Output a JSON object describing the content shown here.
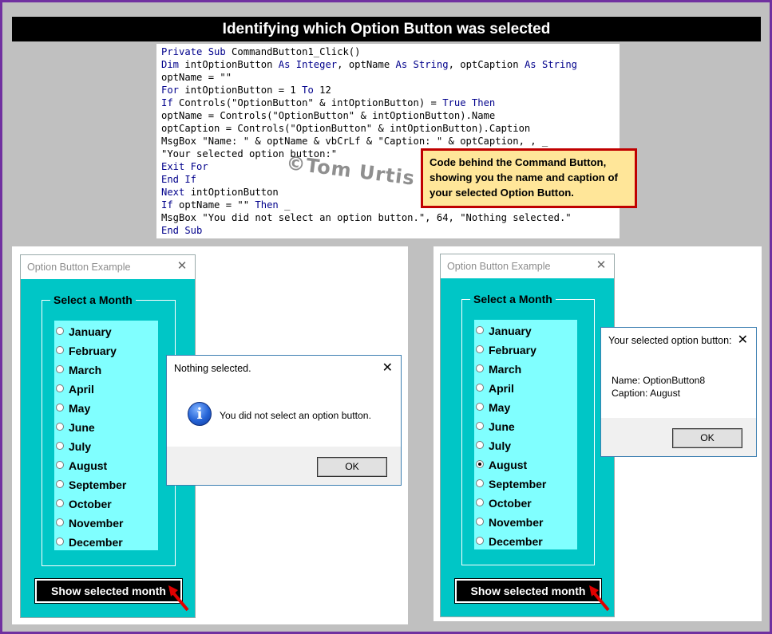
{
  "header": {
    "title": "Identifying which Option Button was selected"
  },
  "code": {
    "lines": [
      [
        {
          "t": "Private Sub",
          "k": true
        },
        {
          "t": " CommandButton1_Click()",
          "k": false
        }
      ],
      [
        {
          "t": "Dim",
          "k": true
        },
        {
          "t": " intOptionButton ",
          "k": false
        },
        {
          "t": "As Integer",
          "k": true
        },
        {
          "t": ", optName ",
          "k": false
        },
        {
          "t": "As String",
          "k": true
        },
        {
          "t": ", optCaption ",
          "k": false
        },
        {
          "t": "As String",
          "k": true
        }
      ],
      [
        {
          "t": "optName = \"\"",
          "k": false
        }
      ],
      [
        {
          "t": "For",
          "k": true
        },
        {
          "t": " intOptionButton = 1 ",
          "k": false
        },
        {
          "t": "To",
          "k": true
        },
        {
          "t": " 12",
          "k": false
        }
      ],
      [
        {
          "t": "If",
          "k": true
        },
        {
          "t": " Controls(\"OptionButton\" & intOptionButton) = ",
          "k": false
        },
        {
          "t": "True Then",
          "k": true
        }
      ],
      [
        {
          "t": "optName = Controls(\"OptionButton\" & intOptionButton).Name",
          "k": false
        }
      ],
      [
        {
          "t": "optCaption = Controls(\"OptionButton\" & intOptionButton).Caption",
          "k": false
        }
      ],
      [
        {
          "t": "MsgBox \"Name: \" & optName & vbCrLf & \"Caption: \" & optCaption, , _",
          "k": false
        }
      ],
      [
        {
          "t": "\"Your selected option button:\"",
          "k": false
        }
      ],
      [
        {
          "t": "Exit For",
          "k": true
        }
      ],
      [
        {
          "t": "End If",
          "k": true
        }
      ],
      [
        {
          "t": "Next",
          "k": true
        },
        {
          "t": " intOptionButton",
          "k": false
        }
      ],
      [
        {
          "t": "If",
          "k": true
        },
        {
          "t": " optName = \"\" ",
          "k": false
        },
        {
          "t": "Then",
          "k": true
        },
        {
          "t": " _",
          "k": false
        }
      ],
      [
        {
          "t": "MsgBox \"You did not select an option button.\", 64, \"Nothing selected.\"",
          "k": false
        }
      ],
      [
        {
          "t": "End Sub",
          "k": true
        }
      ]
    ]
  },
  "watermark": "©Tom Urtis",
  "callout": {
    "text": "Code behind the Command Button, showing you the name and caption of your selected Option Button."
  },
  "forms": [
    {
      "title": "Option Button Example",
      "group_label": "Select a Month",
      "months": [
        "January",
        "February",
        "March",
        "April",
        "May",
        "June",
        "July",
        "August",
        "September",
        "October",
        "November",
        "December"
      ],
      "selected_index": -1,
      "button_label": "Show selected month"
    },
    {
      "title": "Option Button Example",
      "group_label": "Select a Month",
      "months": [
        "January",
        "February",
        "March",
        "April",
        "May",
        "June",
        "July",
        "August",
        "September",
        "October",
        "November",
        "December"
      ],
      "selected_index": 7,
      "button_label": "Show selected month"
    }
  ],
  "msgbox_left": {
    "title": "Nothing selected.",
    "message": "You did not select an option button.",
    "icon": "info-icon",
    "ok_label": "OK"
  },
  "msgbox_right": {
    "title": "Your selected option button:",
    "line1": "Name: OptionButton8",
    "line2": "Caption: August",
    "ok_label": "OK"
  },
  "colors": {
    "frame_border": "#7030a0",
    "form_bg": "#00c6c6",
    "option_bg": "#80ffff",
    "callout_bg": "#ffe699",
    "callout_border": "#c00000",
    "keyword": "#00008b"
  }
}
